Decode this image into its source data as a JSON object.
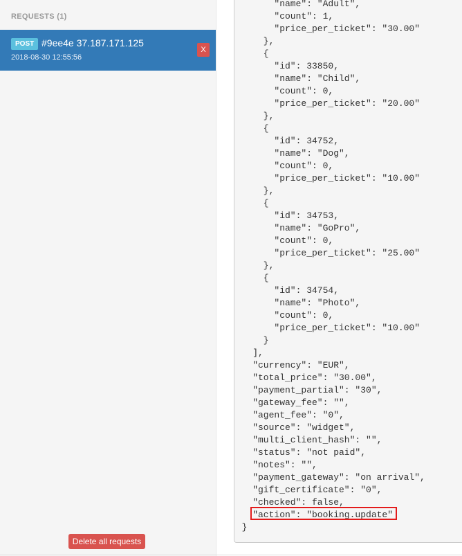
{
  "sidebar": {
    "title": "REQUESTS (1)",
    "requests": [
      {
        "method": "POST",
        "title": "#9ee4e 37.187.171.125",
        "time": "2018-08-30 12:55:56",
        "delete_label": "X"
      }
    ],
    "delete_all_label": "Delete all requests"
  },
  "body_lines": [
    {
      "text": "\"name\": \"Adult\",",
      "indent": 4
    },
    {
      "text": "\"count\": 1,",
      "indent": 4
    },
    {
      "text": "\"price_per_ticket\": \"30.00\"",
      "indent": 4
    },
    {
      "text": "},",
      "indent": 3
    },
    {
      "text": "{",
      "indent": 3
    },
    {
      "text": "\"id\": 33850,",
      "indent": 4
    },
    {
      "text": "\"name\": \"Child\",",
      "indent": 4
    },
    {
      "text": "\"count\": 0,",
      "indent": 4
    },
    {
      "text": "\"price_per_ticket\": \"20.00\"",
      "indent": 4
    },
    {
      "text": "},",
      "indent": 3
    },
    {
      "text": "{",
      "indent": 3
    },
    {
      "text": "\"id\": 34752,",
      "indent": 4
    },
    {
      "text": "\"name\": \"Dog\",",
      "indent": 4
    },
    {
      "text": "\"count\": 0,",
      "indent": 4
    },
    {
      "text": "\"price_per_ticket\": \"10.00\"",
      "indent": 4
    },
    {
      "text": "},",
      "indent": 3
    },
    {
      "text": "{",
      "indent": 3
    },
    {
      "text": "\"id\": 34753,",
      "indent": 4
    },
    {
      "text": "\"name\": \"GoPro\",",
      "indent": 4
    },
    {
      "text": "\"count\": 0,",
      "indent": 4
    },
    {
      "text": "\"price_per_ticket\": \"25.00\"",
      "indent": 4
    },
    {
      "text": "},",
      "indent": 3
    },
    {
      "text": "{",
      "indent": 3
    },
    {
      "text": "\"id\": 34754,",
      "indent": 4
    },
    {
      "text": "\"name\": \"Photo\",",
      "indent": 4
    },
    {
      "text": "\"count\": 0,",
      "indent": 4
    },
    {
      "text": "\"price_per_ticket\": \"10.00\"",
      "indent": 4
    },
    {
      "text": "}",
      "indent": 3
    },
    {
      "text": "],",
      "indent": 2
    },
    {
      "text": "\"currency\": \"EUR\",",
      "indent": 2
    },
    {
      "text": "\"total_price\": \"30.00\",",
      "indent": 2
    },
    {
      "text": "\"payment_partial\": \"30\",",
      "indent": 2
    },
    {
      "text": "\"gateway_fee\": \"\",",
      "indent": 2
    },
    {
      "text": "\"agent_fee\": \"0\",",
      "indent": 2
    },
    {
      "text": "\"source\": \"widget\",",
      "indent": 2
    },
    {
      "text": "\"multi_client_hash\": \"\",",
      "indent": 2
    },
    {
      "text": "\"status\": \"not paid\",",
      "indent": 2
    },
    {
      "text": "\"notes\": \"\",",
      "indent": 2
    },
    {
      "text": "\"payment_gateway\": \"on arrival\",",
      "indent": 2
    },
    {
      "text": "\"gift_certificate\": \"0\",",
      "indent": 2
    },
    {
      "text": "\"checked\": false,",
      "indent": 2
    },
    {
      "text": "\"action\": \"booking.update\"",
      "indent": 2,
      "highlighted": true
    },
    {
      "text": "}",
      "indent": 1
    }
  ]
}
